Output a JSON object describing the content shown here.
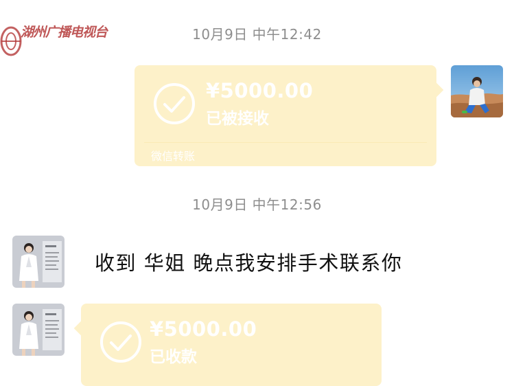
{
  "watermark": {
    "text": "湖州广播电视台"
  },
  "messages": {
    "timestamp_1": "10月9日 中午12:42",
    "transfer_1": {
      "amount": "¥5000.00",
      "status": "已被接收",
      "footer": "微信转账"
    },
    "timestamp_2": "10月9日 中午12:56",
    "text_1": "收到 华姐 晚点我安排手术联系你",
    "transfer_2": {
      "amount": "¥5000.00",
      "status": "已收款"
    }
  },
  "colors": {
    "transfer_bubble": "#fdf1c9",
    "timestamp_text": "#8d8d8d",
    "watermark": "#b43a3a"
  },
  "icons": {
    "received_check": "check-circle-icon",
    "avatar_self": "avatar",
    "avatar_contact": "avatar"
  }
}
